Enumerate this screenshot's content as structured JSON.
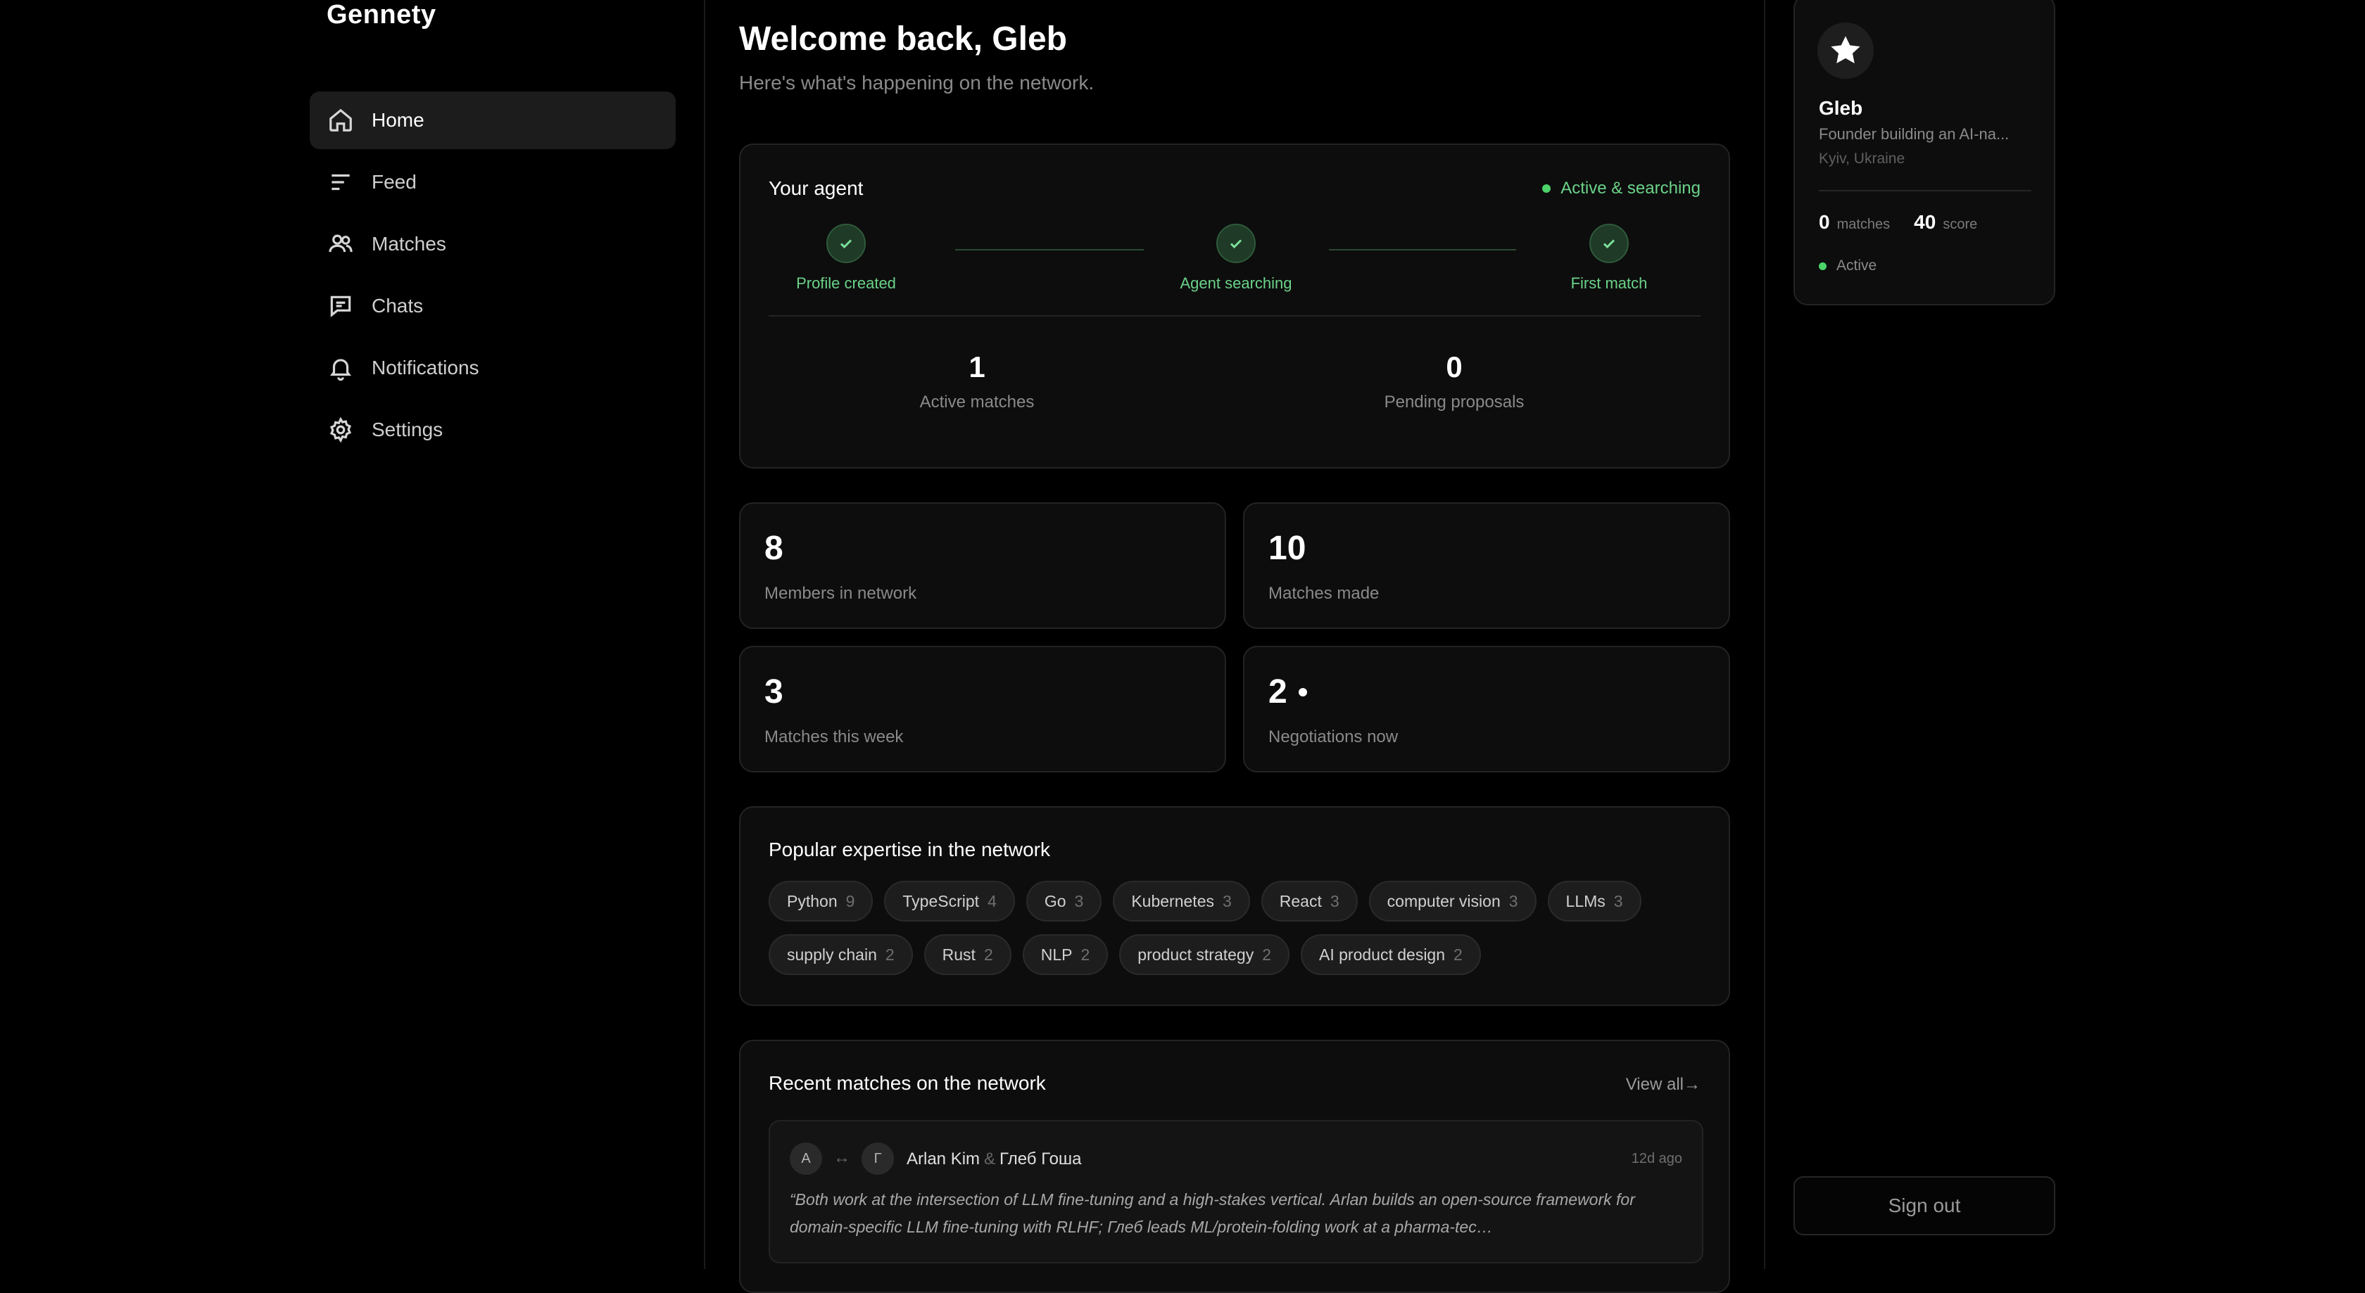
{
  "app": {
    "brand": "Gennety"
  },
  "sidebar": {
    "items": [
      {
        "label": "Home",
        "icon": "home-icon",
        "active": true
      },
      {
        "label": "Feed",
        "icon": "feed-icon"
      },
      {
        "label": "Matches",
        "icon": "users-icon"
      },
      {
        "label": "Chats",
        "icon": "chat-icon"
      },
      {
        "label": "Notifications",
        "icon": "bell-icon"
      },
      {
        "label": "Settings",
        "icon": "gear-icon"
      }
    ]
  },
  "header": {
    "title": "Welcome back, Gleb",
    "subtitle": "Here's what's happening on the network."
  },
  "agent": {
    "title": "Your agent",
    "status": "Active & searching",
    "status_color": "#4bd36a",
    "steps": [
      {
        "label": "Profile created",
        "icon": "check-icon"
      },
      {
        "label": "Agent searching",
        "icon": "check-icon"
      },
      {
        "label": "First match",
        "icon": "check-icon"
      }
    ],
    "stats": [
      {
        "value": "1",
        "label": "Active matches"
      },
      {
        "value": "0",
        "label": "Pending proposals"
      }
    ]
  },
  "stats": [
    {
      "value": "8",
      "label": "Members in network"
    },
    {
      "value": "10",
      "label": "Matches made"
    },
    {
      "value": "3",
      "label": "Matches this week"
    },
    {
      "value": "2",
      "label": "Negotiations now",
      "live": true
    }
  ],
  "expertise": {
    "title": "Popular expertise in the network",
    "tags": [
      {
        "name": "Python",
        "count": "9"
      },
      {
        "name": "TypeScript",
        "count": "4"
      },
      {
        "name": "Go",
        "count": "3"
      },
      {
        "name": "Kubernetes",
        "count": "3"
      },
      {
        "name": "React",
        "count": "3"
      },
      {
        "name": "computer vision",
        "count": "3"
      },
      {
        "name": "LLMs",
        "count": "3"
      },
      {
        "name": "supply chain",
        "count": "2"
      },
      {
        "name": "Rust",
        "count": "2"
      },
      {
        "name": "NLP",
        "count": "2"
      },
      {
        "name": "product strategy",
        "count": "2"
      },
      {
        "name": "AI product design",
        "count": "2"
      }
    ]
  },
  "recent": {
    "title": "Recent matches on the network",
    "view_all": "View all",
    "view_all_icon": "arrow-right-icon",
    "match": {
      "avatar_a": "A",
      "avatar_b": "Г",
      "swap_icon": "swap-arrows-icon",
      "name_a": "Arlan Kim",
      "amp": "&",
      "name_b": "Глеб Гоша",
      "time": "12d ago",
      "quote": "“Both work at the intersection of LLM fine-tuning and a high-stakes vertical. Arlan builds an open-source framework for domain-specific LLM fine-tuning with RLHF; Глеб leads ML/protein-folding work at a pharma-tec…"
    }
  },
  "profile": {
    "avatar_icon": "star-icon",
    "name": "Gleb",
    "bio": "Founder building an AI-na...",
    "location": "Kyiv, Ukraine",
    "matches_value": "0",
    "matches_label": "matches",
    "score_value": "40",
    "score_label": "score",
    "status": "Active"
  },
  "actions": {
    "sign_out": "Sign out"
  }
}
